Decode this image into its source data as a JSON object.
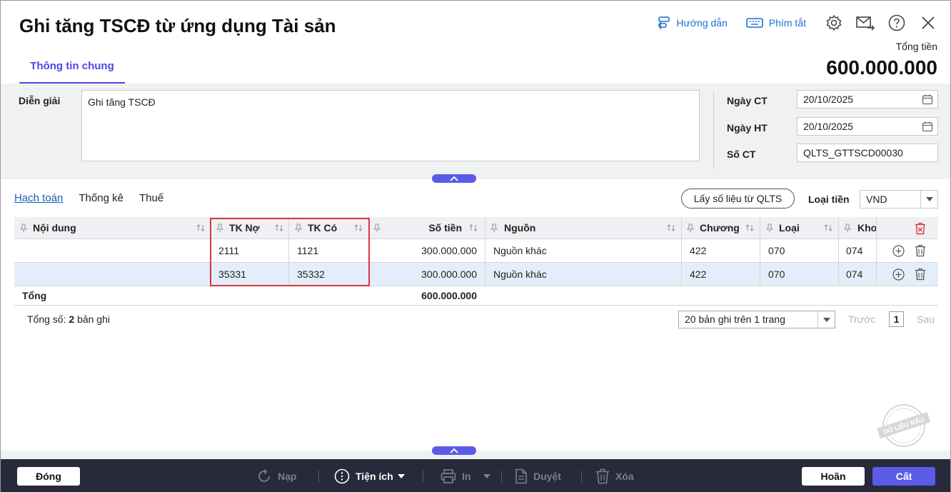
{
  "header": {
    "title": "Ghi tăng TSCĐ từ ứng dụng Tài sản",
    "guide_label": "Hướng dẫn",
    "shortcut_label": "Phím tắt",
    "total_label": "Tổng tiền",
    "total_value": "600.000.000",
    "tab_general": "Thông tin chung"
  },
  "info": {
    "description_label": "Diễn giải",
    "description_value": "Ghi tăng TSCĐ",
    "doc_date_label": "Ngày CT",
    "doc_date_value": "20/10/2025",
    "post_date_label": "Ngày HT",
    "post_date_value": "20/10/2025",
    "doc_no_label": "Số CT",
    "doc_no_value": "QLTS_GTTSCD00030"
  },
  "subtabs": [
    "Hạch toán",
    "Thống kê",
    "Thuế"
  ],
  "toolbar": {
    "fetch_button": "Lấy số liệu từ QLTS",
    "currency_label": "Loại tiền",
    "currency_value": "VND"
  },
  "grid": {
    "columns": [
      "Nội dung",
      "TK Nợ",
      "TK Có",
      "Số tiền",
      "Nguồn",
      "Chương",
      "Loại",
      "Kho"
    ],
    "rows": [
      {
        "content": "",
        "debit": "2111",
        "credit": "1121",
        "amount": "300.000.000",
        "source": "Nguồn khác",
        "chapter": "422",
        "type": "070",
        "store": "074"
      },
      {
        "content": "",
        "debit": "35331",
        "credit": "35332",
        "amount": "300.000.000",
        "source": "Nguồn khác",
        "chapter": "422",
        "type": "070",
        "store": "074"
      }
    ],
    "summary_label": "Tổng",
    "summary_amount": "600.000.000"
  },
  "pager": {
    "total_prefix": "Tổng số:",
    "total_count": "2",
    "total_suffix": "bản ghi",
    "page_size": "20 bản ghi trên 1 trang",
    "prev": "Trước",
    "page": "1",
    "next": "Sau"
  },
  "watermark": "DỮ LIỆU MẪU",
  "footer": {
    "close": "Đóng",
    "reload": "Nạp",
    "utilities": "Tiện ích",
    "print": "In",
    "approve": "Duyệt",
    "delete": "Xóa",
    "undo": "Hoãn",
    "save": "Cất"
  },
  "colors": {
    "accent": "#5a5ce8",
    "link": "#1a6fd1",
    "highlight": "#d9363e",
    "footer_bg": "#262a3b"
  }
}
